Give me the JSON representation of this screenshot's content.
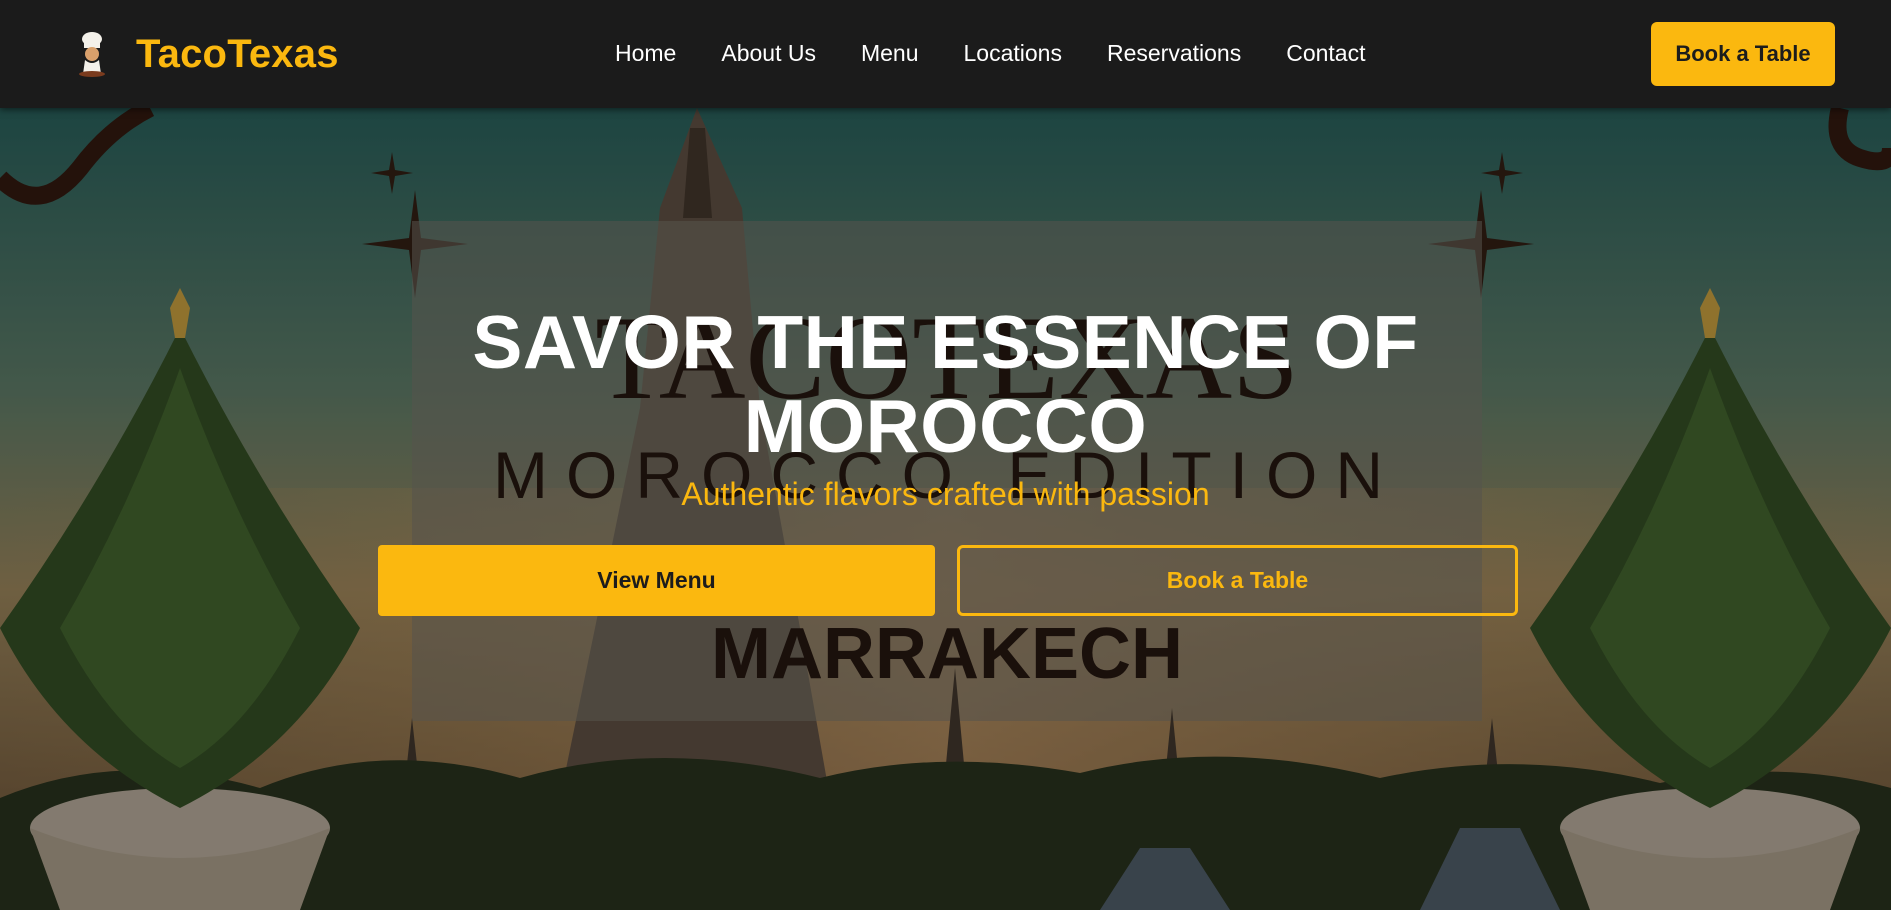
{
  "brand": {
    "name": "TacoTexas",
    "logo_icon": "chef-mascot-icon"
  },
  "nav": {
    "links": [
      "Home",
      "About Us",
      "Menu",
      "Locations",
      "Reservations",
      "Contact"
    ],
    "cta_label": "Book a Table"
  },
  "hero": {
    "background": {
      "poster_title": "TACOTEXAS",
      "poster_edition": "MOROCCO EDITION",
      "poster_city": "MARRAKECH"
    },
    "title_line1": "SAVOR THE ESSENCE OF",
    "title_line2": "MOROCCO",
    "subtitle": "Authentic flavors crafted with passion",
    "primary_button": "View Menu",
    "secondary_button": "Book a Table"
  },
  "colors": {
    "accent": "#fbb80f",
    "nav_bg": "#1b1b1b",
    "text_light": "#ffffff",
    "text_dark": "#1c1c1c"
  }
}
